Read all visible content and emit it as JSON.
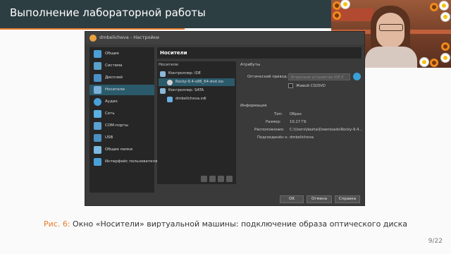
{
  "slide": {
    "title": "Выполнение лабораторной работы",
    "caption_prefix": "Рис. 6:",
    "caption_text": " Окно «Носители» виртуальной машины: подключение образа оптического диска",
    "page_number": "9/22"
  },
  "window": {
    "title": "dmbelicheva - Настройки"
  },
  "sidebar": {
    "items": [
      {
        "label": "Общие",
        "icon": "general-icon",
        "color": "#4aa0d8"
      },
      {
        "label": "Система",
        "icon": "system-icon",
        "color": "#5aa0c8"
      },
      {
        "label": "Дисплей",
        "icon": "display-icon",
        "color": "#4a90c8"
      },
      {
        "label": "Носители",
        "icon": "storage-icon",
        "color": "#7ab0d8",
        "active": true
      },
      {
        "label": "Аудио",
        "icon": "audio-icon",
        "color": "#4aa0d8"
      },
      {
        "label": "Сеть",
        "icon": "network-icon",
        "color": "#5ab0e0"
      },
      {
        "label": "COM-порты",
        "icon": "serial-port-icon",
        "color": "#5aa0d0"
      },
      {
        "label": "USB",
        "icon": "usb-icon",
        "color": "#4a90c0"
      },
      {
        "label": "Общие папки",
        "icon": "shared-folder-icon",
        "color": "#7ab8e0"
      },
      {
        "label": "Интерфейс пользователя",
        "icon": "user-interface-icon",
        "color": "#4aa0d8"
      }
    ]
  },
  "content": {
    "title": "Носители",
    "storage_label": "Носители",
    "attributes_label": "Атрибуты",
    "info_label": "Информация",
    "tree": [
      {
        "label": "Контроллер: IDE",
        "level": 0,
        "icon": "ide-controller-icon"
      },
      {
        "label": "Rocky-9.4-x86_64-dvd.iso",
        "level": 1,
        "icon": "optical-disc-icon",
        "selected": true
      },
      {
        "label": "Контроллер: SATA",
        "level": 0,
        "icon": "sata-controller-icon"
      },
      {
        "label": "dmbelicheva.vdi",
        "level": 1,
        "icon": "hard-disk-icon"
      }
    ],
    "optical_drive_label": "Оптический привод:",
    "optical_drive_value": "Вторичное устройство IDE 0",
    "live_cd_label": "Живой CD/DVD",
    "info": [
      {
        "label": "Тип:",
        "value": "Образ"
      },
      {
        "label": "Размер:",
        "value": "10,17 ГБ"
      },
      {
        "label": "Расположение:",
        "value": "C:\\Users\\dasha\\Downloads\\Rocky-9.4..."
      },
      {
        "label": "Подсоединён к:",
        "value": "dmbelicheva"
      }
    ]
  },
  "buttons": {
    "ok": "OK",
    "cancel": "Отмена",
    "help": "Справка"
  },
  "colors": {
    "header_bg": "#2d3e43",
    "accent": "#e97b2c",
    "selection": "#2b5a6b"
  }
}
